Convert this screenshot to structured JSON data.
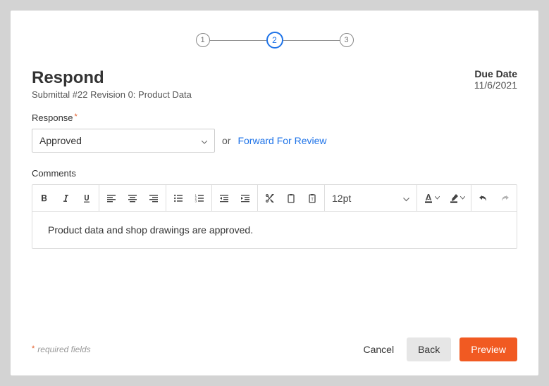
{
  "stepper": {
    "steps": [
      "1",
      "2",
      "3"
    ],
    "active_index": 1
  },
  "header": {
    "title": "Respond",
    "subtitle": "Submittal #22 Revision 0: Product Data",
    "due_date_label": "Due Date",
    "due_date_value": "11/6/2021"
  },
  "response": {
    "label": "Response",
    "selected": "Approved",
    "or_text": "or",
    "forward_link": "Forward For Review"
  },
  "comments": {
    "label": "Comments",
    "font_size": "12pt",
    "body": "Product data and shop drawings are approved."
  },
  "footer": {
    "required_note": "required fields",
    "cancel": "Cancel",
    "back": "Back",
    "preview": "Preview"
  }
}
